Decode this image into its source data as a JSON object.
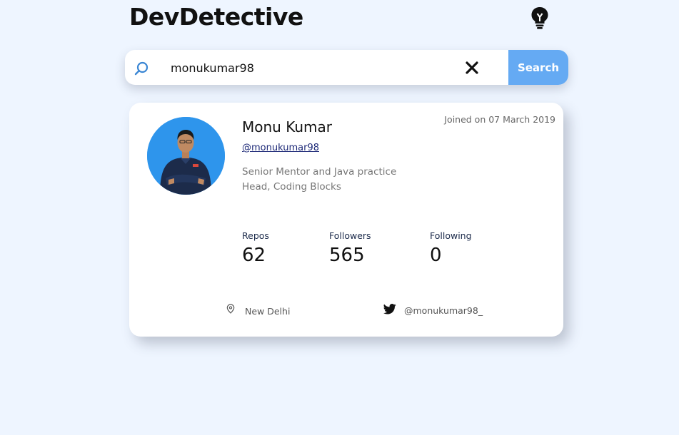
{
  "header": {
    "title": "DevDetective"
  },
  "search": {
    "value": "monukumar98",
    "placeholder": "",
    "button_label": "Search"
  },
  "profile": {
    "name": "Monu Kumar",
    "joined": "Joined on 07 March 2019",
    "handle": "@monukumar98",
    "bio": "Senior Mentor and Java practice Head, Coding Blocks",
    "stats": {
      "repos_label": "Repos",
      "repos": "62",
      "followers_label": "Followers",
      "followers": "565",
      "following_label": "Following",
      "following": "0"
    },
    "location": "New Delhi",
    "twitter": "@monukumar98_"
  },
  "colors": {
    "background": "#eef5ff",
    "accent": "#65aaf3",
    "avatar_bg": "#2e95ec"
  },
  "icons": [
    "search-icon",
    "close-icon",
    "lightbulb-icon",
    "location-pin-icon",
    "twitter-icon"
  ]
}
